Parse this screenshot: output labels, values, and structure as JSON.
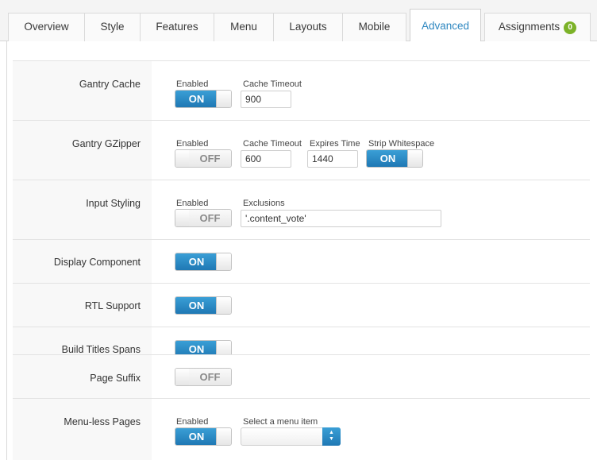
{
  "tabs": [
    {
      "label": "Overview"
    },
    {
      "label": "Style"
    },
    {
      "label": "Features"
    },
    {
      "label": "Menu"
    },
    {
      "label": "Layouts"
    },
    {
      "label": "Mobile"
    },
    {
      "label": "Advanced"
    },
    {
      "label": "Assignments",
      "badge": "0"
    }
  ],
  "active_tab": "Advanced",
  "colors": {
    "accent": "#2e87c0",
    "toggle_on": "#1f78b4",
    "badge": "#7cb228"
  },
  "settings": {
    "gantry_cache": {
      "label": "Gantry Cache",
      "enabled_caption": "Enabled",
      "enabled_value": "ON",
      "timeout_caption": "Cache Timeout",
      "timeout_value": "900"
    },
    "gantry_gzipper": {
      "label": "Gantry GZipper",
      "enabled_caption": "Enabled",
      "enabled_value": "OFF",
      "timeout_caption": "Cache Timeout",
      "timeout_value": "600",
      "expires_caption": "Expires Time",
      "expires_value": "1440",
      "strip_caption": "Strip Whitespace",
      "strip_value": "ON"
    },
    "input_styling": {
      "label": "Input Styling",
      "enabled_caption": "Enabled",
      "enabled_value": "OFF",
      "exclusions_caption": "Exclusions",
      "exclusions_value": "'.content_vote'"
    },
    "display_component": {
      "label": "Display Component",
      "value": "ON"
    },
    "rtl_support": {
      "label": "RTL Support",
      "value": "ON"
    },
    "build_titles_spans": {
      "label": "Build Titles Spans",
      "value": "ON"
    },
    "page_suffix": {
      "label": "Page Suffix",
      "value": "OFF"
    },
    "menu_less_pages": {
      "label": "Menu-less Pages",
      "enabled_caption": "Enabled",
      "enabled_value": "ON",
      "menu_caption": "Select a menu item",
      "menu_value": ""
    }
  }
}
